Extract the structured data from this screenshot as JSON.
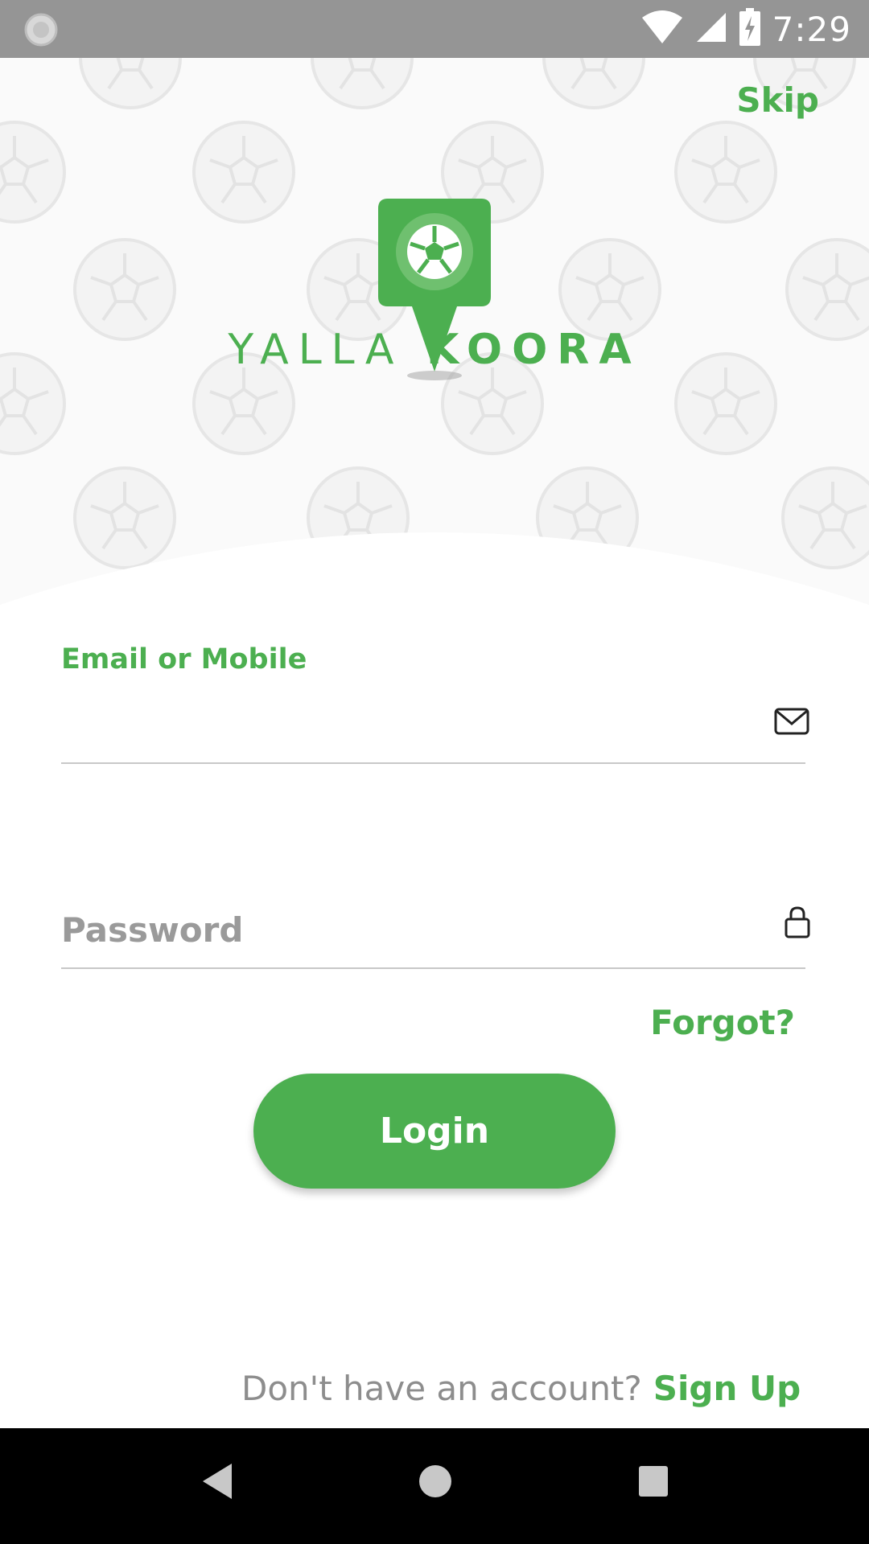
{
  "status_bar": {
    "time": "7:29",
    "icons": [
      "sync-icon",
      "wifi-icon",
      "signal-icon",
      "battery-charging-icon"
    ]
  },
  "header": {
    "skip_label": "Skip",
    "brand_part1": "YALLA",
    "brand_part2": "KOORA",
    "logo_icon": "soccer-ball-pin-icon"
  },
  "form": {
    "email_label": "Email or Mobile",
    "email_value": "",
    "email_icon": "mail-icon",
    "password_placeholder": "Password",
    "password_icon": "lock-icon",
    "forgot_label": "Forgot?",
    "login_label": "Login"
  },
  "footer": {
    "signup_prompt": "Don't have an account?",
    "signup_label": "Sign Up"
  },
  "nav_bar": {
    "buttons": [
      "back-icon",
      "home-icon",
      "recents-icon"
    ]
  },
  "colors": {
    "accent": "#4caf50",
    "status_bar": "#959595",
    "nav_bar": "#000000"
  }
}
